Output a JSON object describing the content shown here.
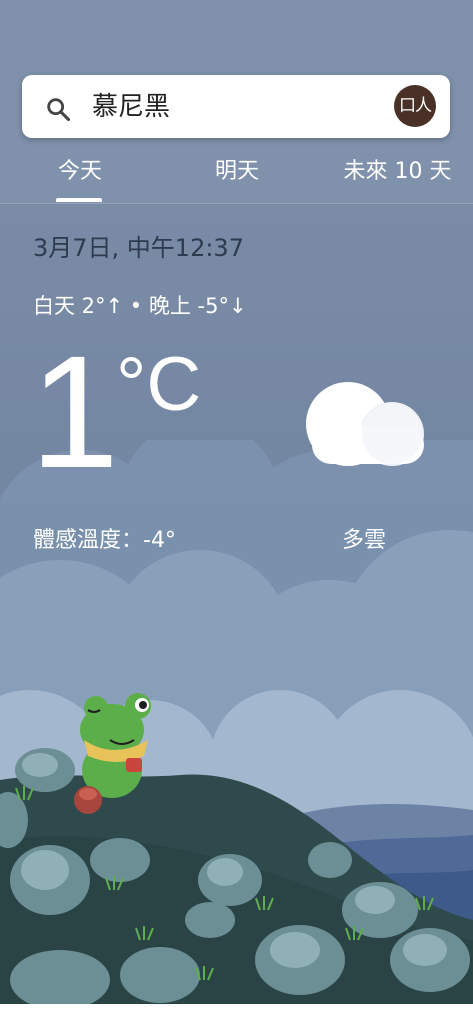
{
  "search": {
    "query": "慕尼黑",
    "account_initials": "口人"
  },
  "tabs": [
    {
      "label": "今天",
      "selected": true
    },
    {
      "label": "明天",
      "selected": false
    },
    {
      "label": "未來 10 天",
      "selected": false
    }
  ],
  "weather": {
    "datetime": "3月7日, 中午12:37",
    "high_low": "白天 2°↑ • 晚上 -5°↓",
    "temperature": "1",
    "unit": "°C",
    "feels_like": "體感溫度：-4°",
    "condition": "多雲",
    "condition_icon": "cloud-icon"
  },
  "colors": {
    "header_bg": "#7f91ab",
    "datetime_text": "#2e3a4d",
    "avatar_bg": "#4a3128",
    "frog_green": "#5cae4b"
  }
}
